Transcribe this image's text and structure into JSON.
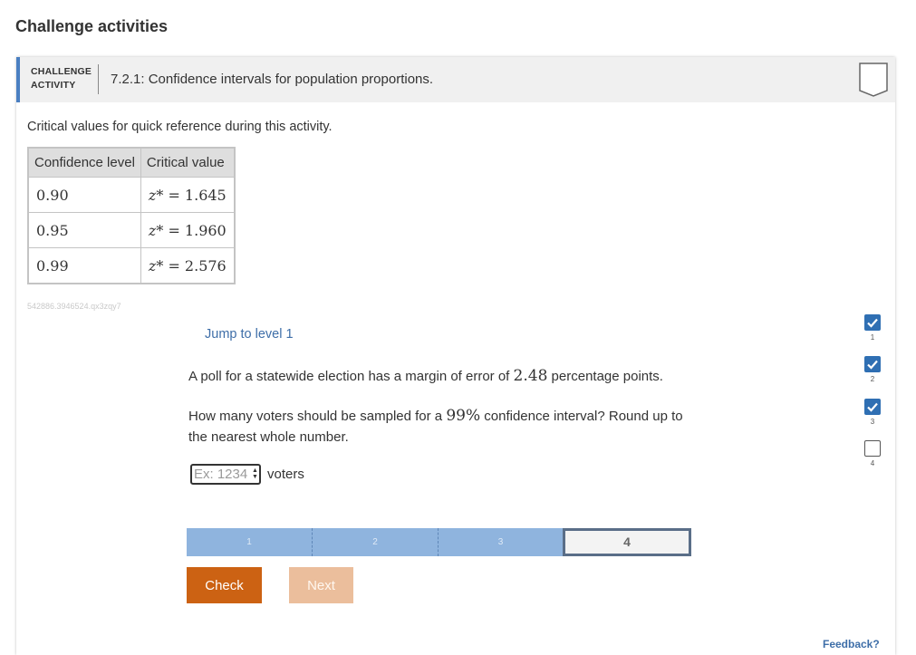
{
  "section_title": "Challenge activities",
  "activity": {
    "type_label": "CHALLENGE ACTIVITY",
    "title": "7.2.1: Confidence intervals for population proportions."
  },
  "intro": "Critical values for quick reference during this activity.",
  "table": {
    "headers": [
      "Confidence level",
      "Critical value"
    ],
    "rows": [
      {
        "level": "0.90",
        "z_prefix": "z*",
        "value": "= 1.645"
      },
      {
        "level": "0.95",
        "z_prefix": "z*",
        "value": "= 1.960"
      },
      {
        "level": "0.99",
        "z_prefix": "z*",
        "value": "= 2.576"
      }
    ]
  },
  "activity_id": "542886.3946524.qx3zqy7",
  "jump_link": "Jump to level 1",
  "question": {
    "line1_pre": "A poll for a statewide election has a margin of error of ",
    "margin": "2.48",
    "line1_post": " percentage points.",
    "line2_pre": "How many voters should be sampled for a ",
    "confidence": "99%",
    "line2_post": " confidence interval? Round up to the nearest whole number."
  },
  "answer": {
    "placeholder": "Ex: 1234",
    "value": "",
    "unit": "voters"
  },
  "progress": {
    "segments": [
      "1",
      "2",
      "3",
      "4"
    ],
    "current": 4
  },
  "buttons": {
    "check": "Check",
    "next": "Next"
  },
  "levels": [
    {
      "num": "1",
      "completed": true
    },
    {
      "num": "2",
      "completed": true
    },
    {
      "num": "3",
      "completed": true
    },
    {
      "num": "4",
      "completed": false
    }
  ],
  "feedback_link": "Feedback?",
  "colors": {
    "accent_blue": "#2f6fb3",
    "check_orange": "#cc6213",
    "next_disabled": "#ebbe9c",
    "progress_done": "#8fb4de",
    "link": "#3e6ea8"
  }
}
